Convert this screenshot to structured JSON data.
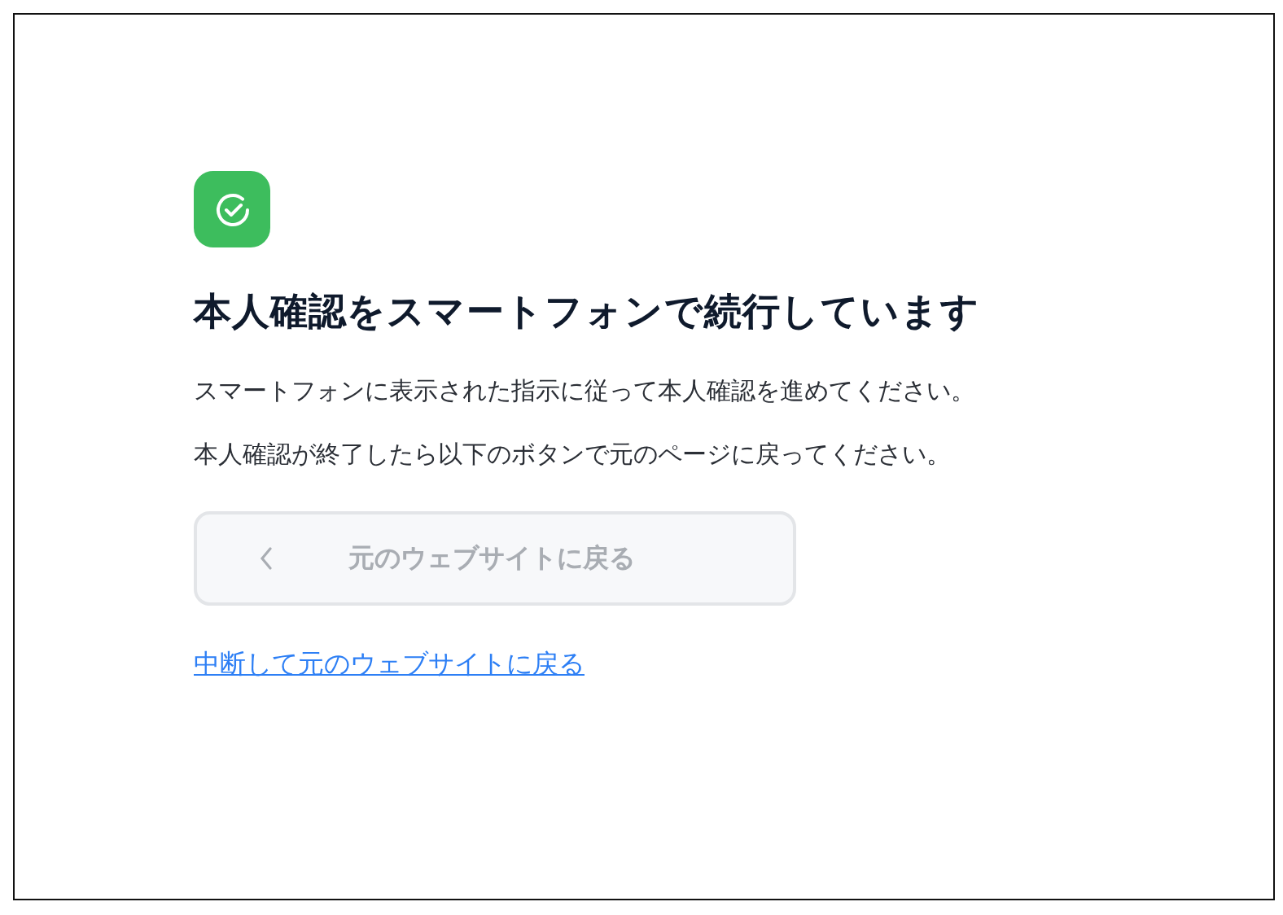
{
  "heading": "本人確認をスマートフォンで続行しています",
  "paragraphs": [
    "スマートフォンに表示された指示に従って本人確認を進めてください。",
    "本人確認が終了したら以下のボタンで元のページに戻ってください。"
  ],
  "back_button": {
    "label": "元のウェブサイトに戻る",
    "disabled": true
  },
  "cancel_link": "中断して元のウェブサイトに戻る"
}
